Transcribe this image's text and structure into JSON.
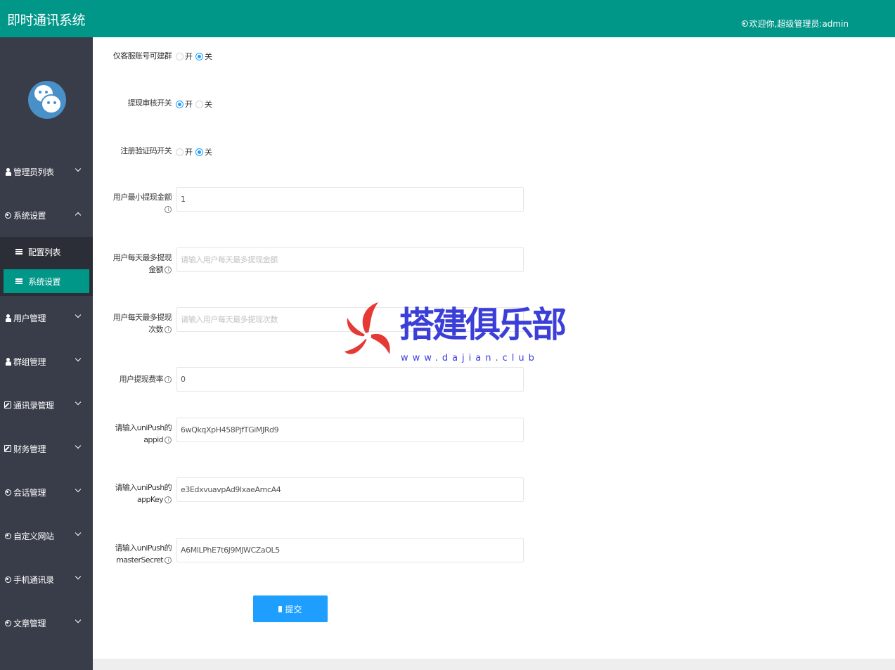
{
  "header": {
    "title": "即时通讯系统",
    "welcome": "欢迎你,超级管理员:admin"
  },
  "sidebar": {
    "items": [
      {
        "label": "管理员列表"
      },
      {
        "label": "系统设置"
      },
      {
        "label": "用户管理"
      },
      {
        "label": "群组管理"
      },
      {
        "label": "通讯录管理"
      },
      {
        "label": "财务管理"
      },
      {
        "label": "会话管理"
      },
      {
        "label": "自定义网站"
      },
      {
        "label": "手机通讯录"
      },
      {
        "label": "文章管理"
      }
    ],
    "subitems": [
      {
        "label": "配置列表"
      },
      {
        "label": "系统设置"
      }
    ]
  },
  "form": {
    "radio_on": "开",
    "radio_off": "关",
    "service_only_group": {
      "label": "仅客服账号可建群",
      "value": "关"
    },
    "withdraw_review": {
      "label": "提现审核开关",
      "value": "开"
    },
    "register_captcha": {
      "label": "注册验证码开关",
      "value": "关"
    },
    "min_withdraw": {
      "label": "用户最小提现金额",
      "value": "1"
    },
    "max_daily_amount": {
      "label": "用户每天最多提现金额",
      "placeholder": "请输入用户每天最多提现金额"
    },
    "max_daily_times": {
      "label": "用户每天最多提现次数",
      "placeholder": "请输入用户每天最多提现次数"
    },
    "withdraw_fee": {
      "label": "用户提现费率",
      "value": "0"
    },
    "unipush_appid": {
      "label": "请输入uniPush的appid",
      "value": "6wQkqXpH458PjfTGiMJRd9"
    },
    "unipush_appkey": {
      "label": "请输入uniPush的appKey",
      "value": "e3EdxvuavpAd9lxaeAmcA4"
    },
    "unipush_master": {
      "label": "请输入uniPush的masterSecret",
      "value": "A6MlLPhE7t6J9MJWCZaOL5"
    },
    "submit_label": "提交"
  },
  "watermark": {
    "text": "搭建俱乐部",
    "url": "www.dajian.club"
  },
  "colors": {
    "header": "#009688",
    "sidebar": "#393d49",
    "accent": "#1e9fff",
    "watermark": "#3b3fd8"
  }
}
